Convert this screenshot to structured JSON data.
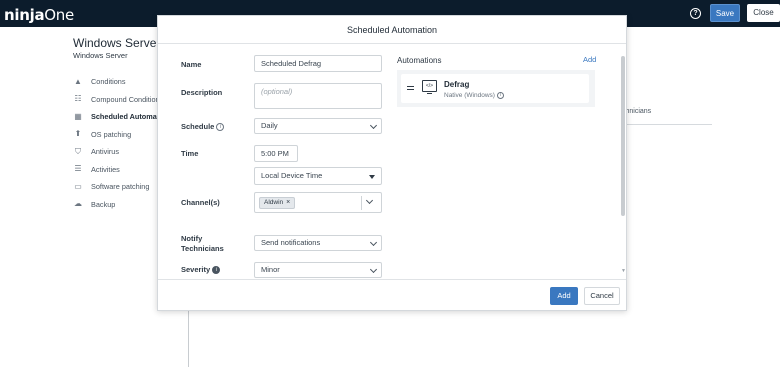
{
  "topbar": {
    "logo_main": "ninja",
    "logo_accent": "One",
    "help_icon": "help-circle-icon",
    "save_label": "Save",
    "close_label": "Close"
  },
  "page": {
    "title": "Windows Server I",
    "subtitle": "Windows Server",
    "nav": [
      {
        "label": "Conditions",
        "icon": "warning-triangle-icon"
      },
      {
        "label": "Compound Conditions",
        "icon": "compound-list-icon"
      },
      {
        "label": "Scheduled Automation",
        "icon": "calendar-icon"
      },
      {
        "label": "OS patching",
        "icon": "arrow-up-circle-icon"
      },
      {
        "label": "Antivirus",
        "icon": "shield-icon"
      },
      {
        "label": "Activities",
        "icon": "list-icon"
      },
      {
        "label": "Software patching",
        "icon": "window-icon"
      },
      {
        "label": "Backup",
        "icon": "cloud-upload-icon"
      }
    ],
    "bg_text": "y\nchnicians"
  },
  "modal": {
    "title": "Scheduled Automation",
    "name_label": "Name",
    "name_value": "Scheduled Defrag",
    "description_label": "Description",
    "description_placeholder": "(optional)",
    "schedule_label": "Schedule",
    "schedule_value": "Daily",
    "time_label": "Time",
    "time_value": "5:00 PM",
    "timezone_value": "Local Device Time",
    "channels_label": "Channel(s)",
    "channel_chip": "Aldwin",
    "notify_label_1": "Notify",
    "notify_label_2": "Technicians",
    "notify_value": "Send notifications",
    "severity_label": "Severity",
    "severity_value": "Minor",
    "automations_title": "Automations",
    "automations_add": "Add",
    "automation": {
      "name": "Defrag",
      "type": "Native (Windows)"
    },
    "add_button": "Add",
    "cancel_button": "Cancel"
  }
}
